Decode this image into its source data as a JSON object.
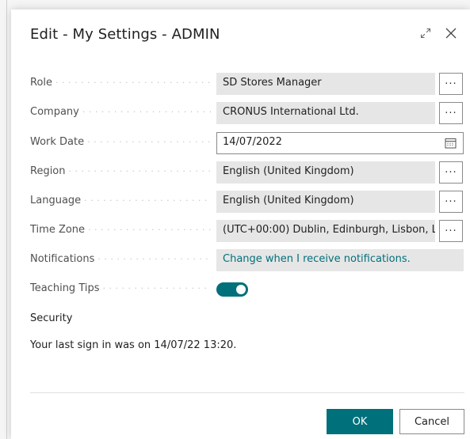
{
  "dialog": {
    "title": "Edit - My Settings - ADMIN",
    "icons": [
      "expand-icon",
      "close-icon"
    ]
  },
  "fields": {
    "role": {
      "label": "Role",
      "value": "SD Stores Manager",
      "more": "···"
    },
    "company": {
      "label": "Company",
      "value": "CRONUS International Ltd.",
      "more": "···"
    },
    "work_date": {
      "label": "Work Date",
      "value": "14/07/2022",
      "icon": "calendar-icon"
    },
    "region": {
      "label": "Region",
      "value": "English (United Kingdom)",
      "more": "···"
    },
    "language": {
      "label": "Language",
      "value": "English (United Kingdom)",
      "more": "···"
    },
    "time_zone": {
      "label": "Time Zone",
      "value": "(UTC+00:00) Dublin, Edinburgh, Lisbon, L...",
      "more": "···"
    },
    "notifications": {
      "label": "Notifications",
      "value": "Change when I receive notifications."
    },
    "teaching_tips": {
      "label": "Teaching Tips",
      "on": true
    }
  },
  "security": {
    "heading": "Security",
    "last_signin": "Your last sign in was on 14/07/22 13:20."
  },
  "buttons": {
    "ok": "OK",
    "cancel": "Cancel"
  },
  "colors": {
    "accent": "#00707a",
    "field_bg": "#e6e6e6"
  }
}
